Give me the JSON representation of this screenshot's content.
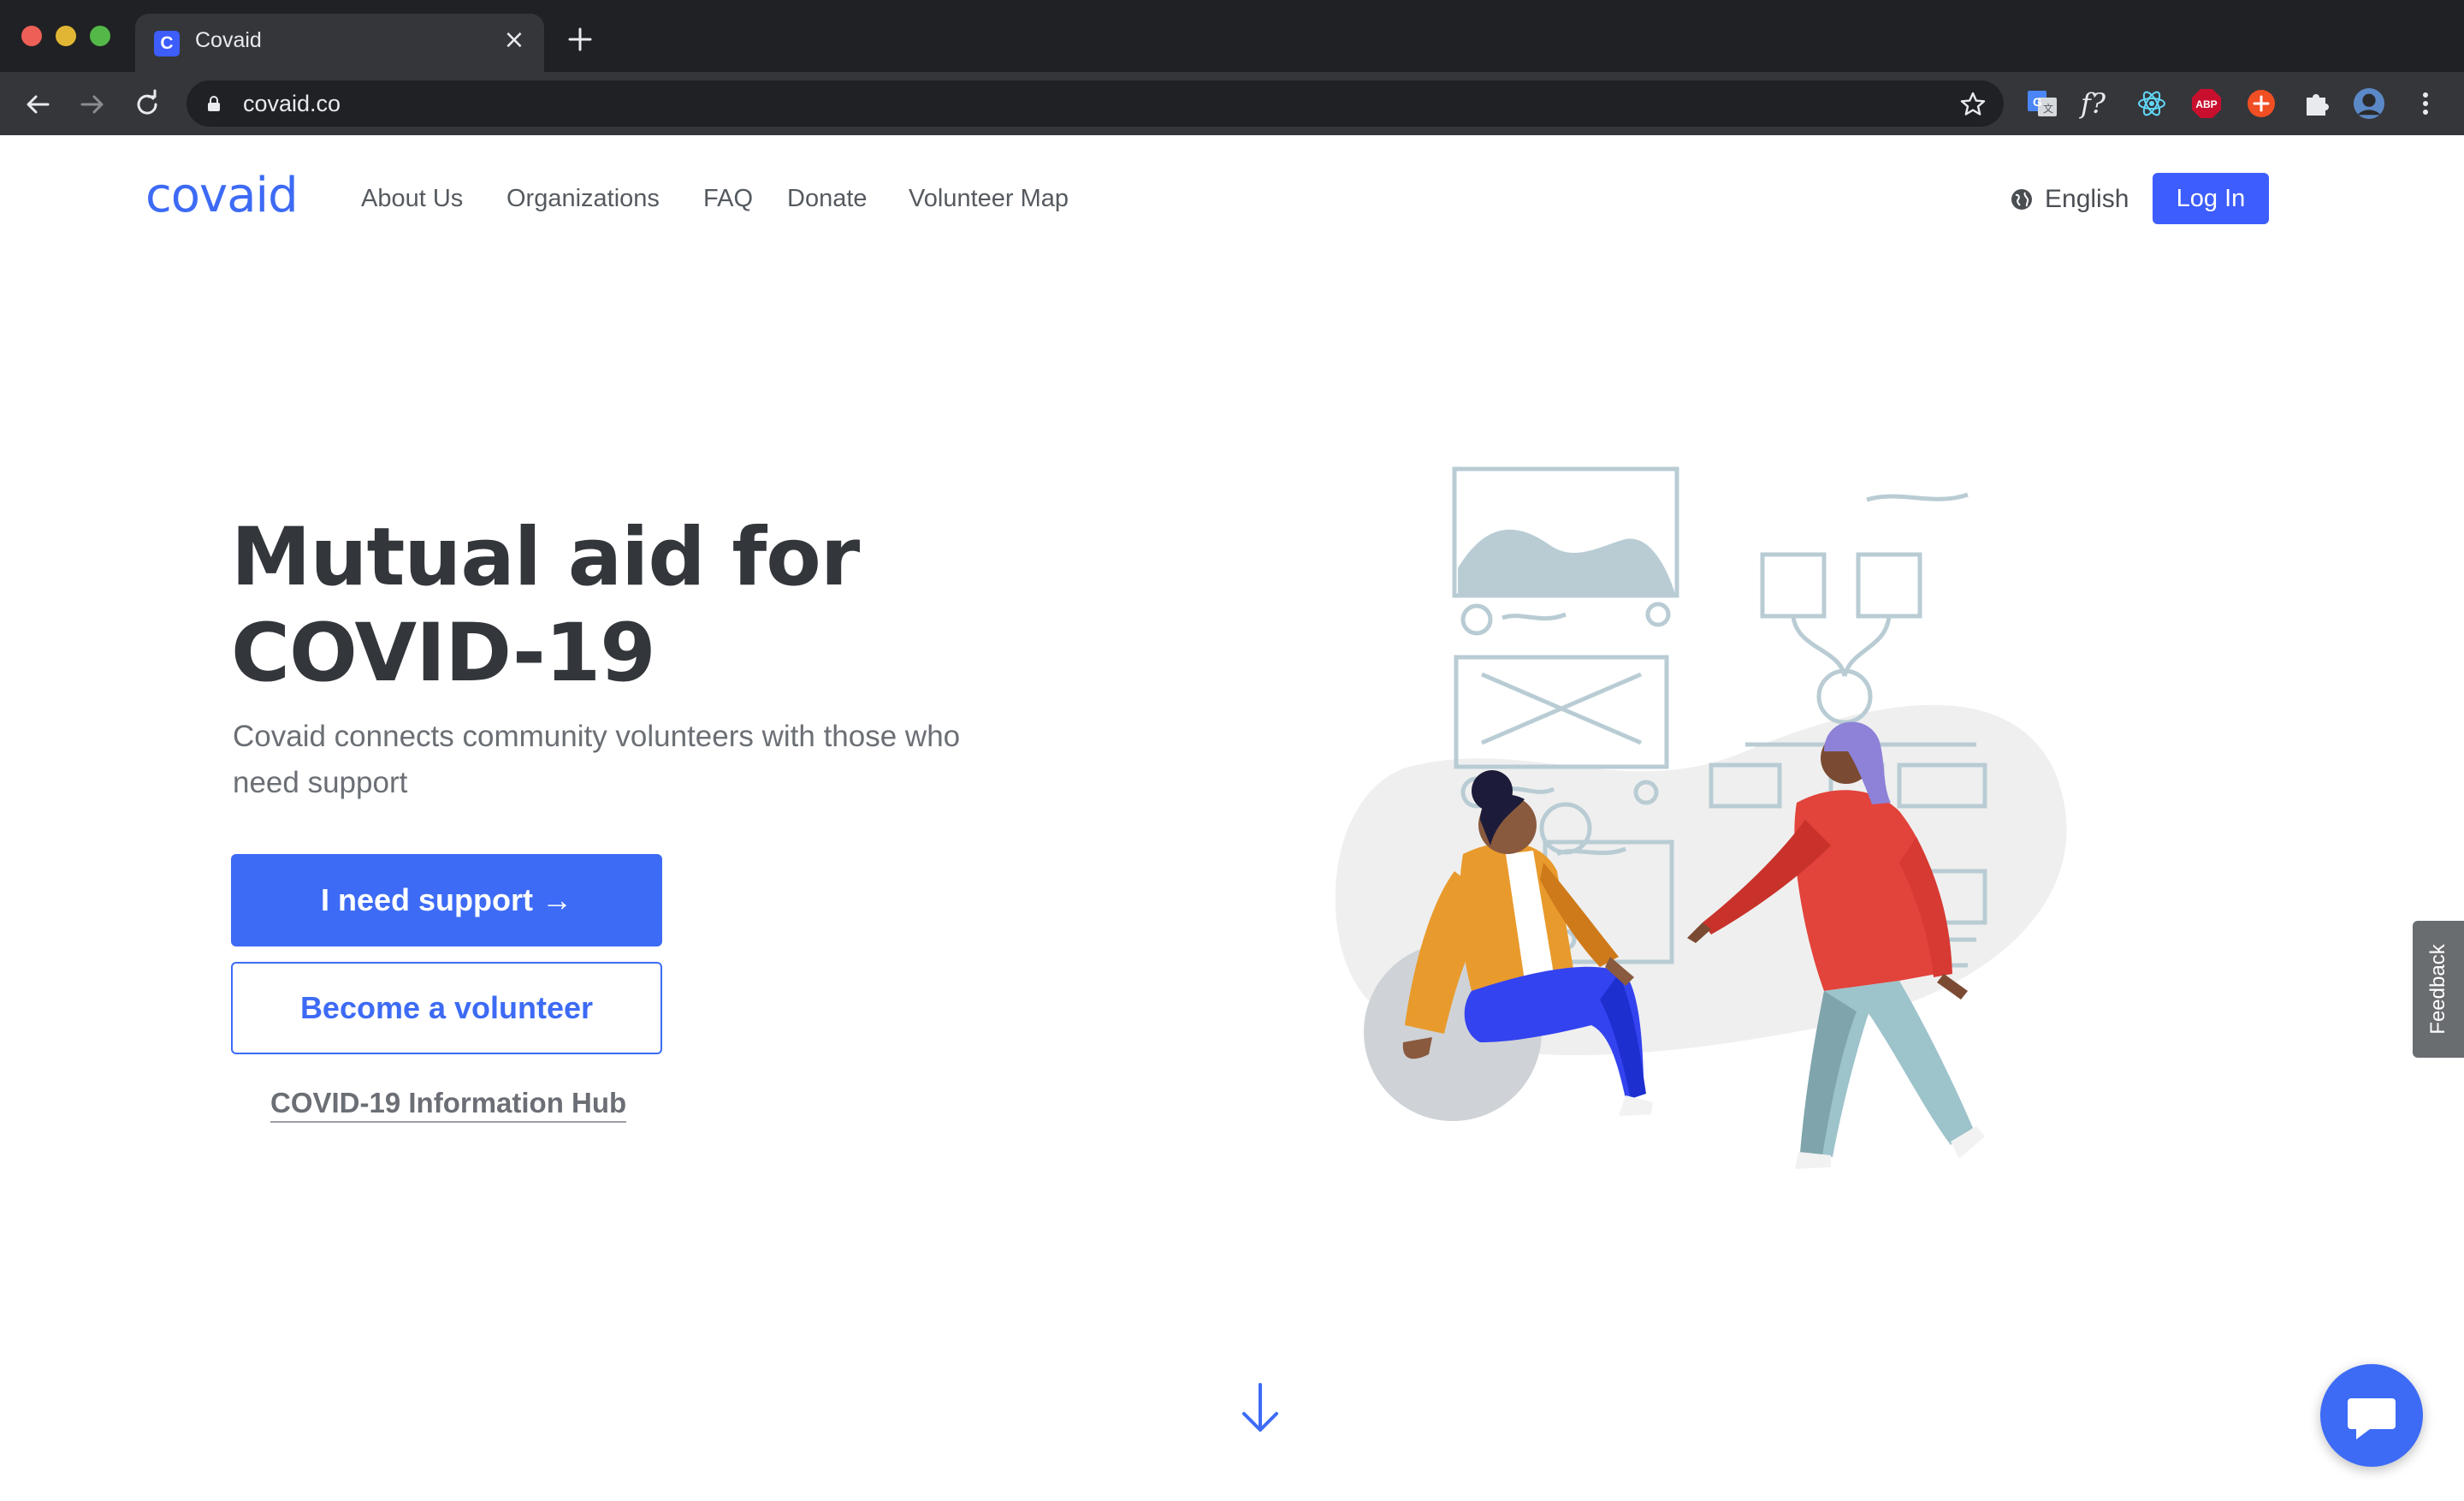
{
  "browser": {
    "tab_title": "Covaid",
    "tab_favicon_letter": "C",
    "url": "covaid.co",
    "extensions": [
      "translate-icon",
      "fx-icon",
      "react-icon",
      "abp-icon",
      "plus-circle-icon",
      "puzzle-icon",
      "profile-avatar",
      "menu-dots-icon"
    ],
    "fx_label": "f?",
    "abp_label": "ABP"
  },
  "header": {
    "logo": "covaid",
    "nav": [
      "About Us",
      "Organizations",
      "FAQ",
      "Donate",
      "Volunteer Map"
    ],
    "language": "English",
    "login": "Log In"
  },
  "hero": {
    "title_line1": "Mutual aid for",
    "title_line2": "COVID-19",
    "subtitle": "Covaid connects community volunteers with those who need support",
    "primary_button": "I need support →",
    "secondary_button": "Become a volunteer",
    "info_link": "COVID-19 Information Hub"
  },
  "feedback_tab": "Feedback",
  "colors": {
    "brand": "#3d6bf5",
    "text_dark": "#33363b",
    "text_muted": "#6b6f75",
    "chrome_dark": "#202124"
  }
}
